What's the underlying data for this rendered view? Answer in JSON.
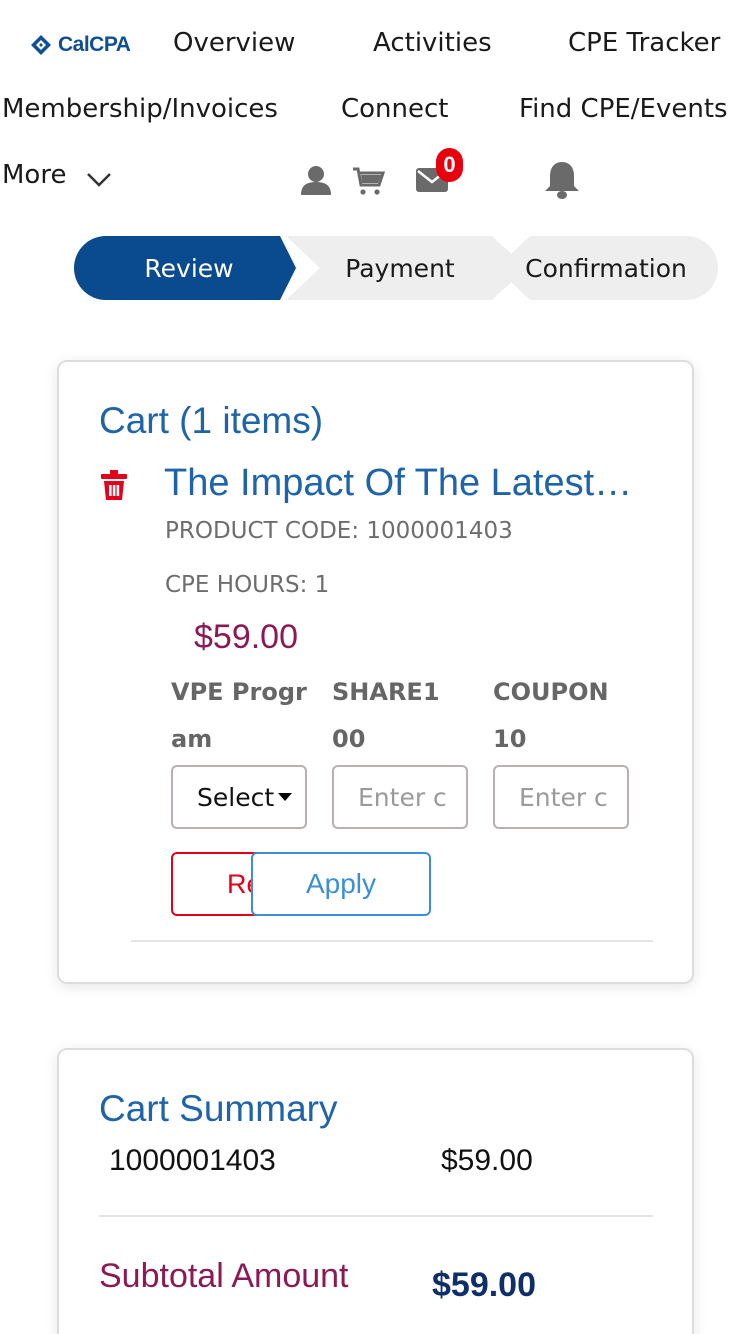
{
  "nav": {
    "logo_text": "CalCPA",
    "links": [
      "Overview",
      "Activities",
      "CPE Tracker",
      "Membership/Invoices",
      "Connect",
      "Find CPE/Events"
    ],
    "more_label": "More",
    "mail_badge": "0",
    "icons": [
      "user-icon",
      "cart-icon",
      "mail-icon",
      "bell-icon",
      "chevron-down-icon"
    ]
  },
  "steps": [
    {
      "label": "Review",
      "active": true
    },
    {
      "label": "Payment",
      "active": false
    },
    {
      "label": "Confirmation",
      "active": false
    }
  ],
  "cart": {
    "title": "Cart (1 items)",
    "item": {
      "title": "The Impact Of The Latest…",
      "product_code": "PRODUCT CODE: 1000001403",
      "cpe_hours": "CPE HOURS: 1",
      "price": "$59.00",
      "fields": [
        {
          "label": "VPE Program",
          "type": "select",
          "value": "Select"
        },
        {
          "label": "SHARE100",
          "type": "input",
          "placeholder": "Enter c"
        },
        {
          "label": "COUPON10",
          "type": "input",
          "placeholder": "Enter c"
        }
      ],
      "remove_label": "Remove",
      "apply_label": "Apply"
    }
  },
  "summary": {
    "title": "Cart Summary",
    "rows": [
      {
        "code": "1000001403",
        "amount": "$59.00"
      }
    ],
    "subtotal_label": "Subtotal Amount",
    "subtotal_value": "$59.00"
  },
  "colors": {
    "brand_blue": "#0f4f96",
    "title_blue": "#1f63a8",
    "price_maroon": "#8b1a54",
    "remove_red": "#e2001a",
    "apply_blue": "#3c8fd6",
    "badge_red": "#e8000d"
  }
}
